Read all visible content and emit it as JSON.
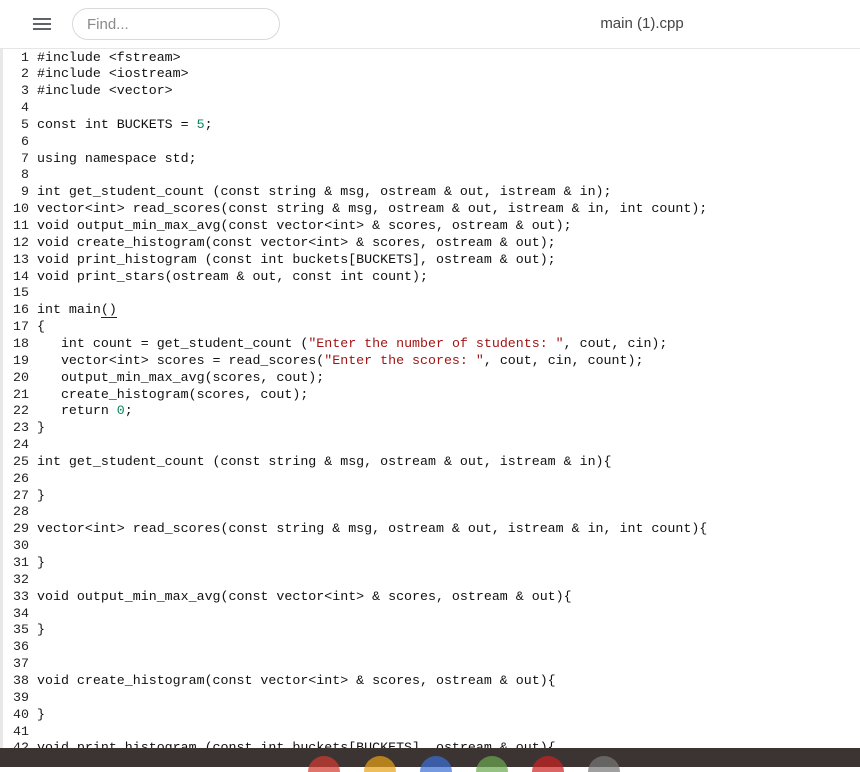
{
  "header": {
    "menu_icon": "hamburger-menu-icon",
    "search_placeholder": "Find...",
    "file_title": "main (1).cpp"
  },
  "editor": {
    "lines": [
      {
        "n": "1",
        "segs": [
          {
            "t": "#include <fstream>"
          }
        ]
      },
      {
        "n": "2",
        "segs": [
          {
            "t": "#include <iostream>"
          }
        ]
      },
      {
        "n": "3",
        "segs": [
          {
            "t": "#include <vector>"
          }
        ]
      },
      {
        "n": "4",
        "segs": []
      },
      {
        "n": "5",
        "segs": [
          {
            "t": "const int BUCKETS = "
          },
          {
            "t": "5",
            "c": "num"
          },
          {
            "t": ";"
          }
        ]
      },
      {
        "n": "6",
        "segs": []
      },
      {
        "n": "7",
        "segs": [
          {
            "t": "using namespace std;"
          }
        ]
      },
      {
        "n": "8",
        "segs": []
      },
      {
        "n": "9",
        "segs": [
          {
            "t": "int get_student_count (const string & msg, ostream & out, istream & in);"
          }
        ]
      },
      {
        "n": "10",
        "segs": [
          {
            "t": "vector<int> read_scores(const string & msg, ostream & out, istream & in, int count);"
          }
        ]
      },
      {
        "n": "11",
        "segs": [
          {
            "t": "void output_min_max_avg(const vector<int> & scores, ostream & out);"
          }
        ]
      },
      {
        "n": "12",
        "segs": [
          {
            "t": "void create_histogram(const vector<int> & scores, ostream & out);"
          }
        ]
      },
      {
        "n": "13",
        "segs": [
          {
            "t": "void print_histogram (const int buckets[BUCKETS], ostream & out);"
          }
        ]
      },
      {
        "n": "14",
        "segs": [
          {
            "t": "void print_stars(ostream & out, const int count);"
          }
        ]
      },
      {
        "n": "15",
        "segs": []
      },
      {
        "n": "16",
        "segs": [
          {
            "t": "int main"
          },
          {
            "t": "()",
            "c": "underline"
          }
        ]
      },
      {
        "n": "17",
        "segs": [
          {
            "t": "{"
          }
        ]
      },
      {
        "n": "18",
        "segs": [
          {
            "t": "   int count = get_student_count ("
          },
          {
            "t": "\"Enter the number of students: \"",
            "c": "str"
          },
          {
            "t": ", cout, cin);"
          }
        ]
      },
      {
        "n": "19",
        "segs": [
          {
            "t": "   vector<int> scores = read_scores("
          },
          {
            "t": "\"Enter the scores: \"",
            "c": "str"
          },
          {
            "t": ", cout, cin, count);"
          }
        ]
      },
      {
        "n": "20",
        "segs": [
          {
            "t": "   output_min_max_avg(scores, cout);"
          }
        ]
      },
      {
        "n": "21",
        "segs": [
          {
            "t": "   create_histogram(scores, cout);"
          }
        ]
      },
      {
        "n": "22",
        "segs": [
          {
            "t": "   return "
          },
          {
            "t": "0",
            "c": "num"
          },
          {
            "t": ";"
          }
        ]
      },
      {
        "n": "23",
        "segs": [
          {
            "t": "}"
          }
        ]
      },
      {
        "n": "24",
        "segs": []
      },
      {
        "n": "25",
        "segs": [
          {
            "t": "int get_student_count (const string & msg, ostream & out, istream & in){"
          }
        ]
      },
      {
        "n": "26",
        "segs": []
      },
      {
        "n": "27",
        "segs": [
          {
            "t": "}"
          }
        ]
      },
      {
        "n": "28",
        "segs": []
      },
      {
        "n": "29",
        "segs": [
          {
            "t": "vector<int> read_scores(const string & msg, ostream & out, istream & in, int count){"
          }
        ]
      },
      {
        "n": "30",
        "segs": []
      },
      {
        "n": "31",
        "segs": [
          {
            "t": "}"
          }
        ]
      },
      {
        "n": "32",
        "segs": []
      },
      {
        "n": "33",
        "segs": [
          {
            "t": "void output_min_max_avg(const vector<int> & scores, ostream & out){"
          }
        ]
      },
      {
        "n": "34",
        "segs": []
      },
      {
        "n": "35",
        "segs": [
          {
            "t": "}"
          }
        ]
      },
      {
        "n": "36",
        "segs": []
      },
      {
        "n": "37",
        "segs": []
      },
      {
        "n": "38",
        "segs": [
          {
            "t": "void create_histogram(const vector<int> & scores, ostream & out){"
          }
        ]
      },
      {
        "n": "39",
        "segs": []
      },
      {
        "n": "40",
        "segs": [
          {
            "t": "}"
          }
        ]
      },
      {
        "n": "41",
        "segs": []
      },
      {
        "n": "42",
        "segs": [
          {
            "t": "void print_histogram (const int buckets[BUCKETS], ostream & out){"
          }
        ]
      }
    ]
  },
  "taskbar": {
    "icons": [
      {
        "name": "chrome-icon",
        "color": "#d23b2f"
      },
      {
        "name": "gmail-icon",
        "color": "#e8a317"
      },
      {
        "name": "docs-icon",
        "color": "#3b6fd6"
      },
      {
        "name": "play-store-icon",
        "color": "#6aa84f"
      },
      {
        "name": "youtube-icon",
        "color": "#cc2222"
      },
      {
        "name": "files-icon",
        "color": "#777777"
      }
    ]
  }
}
